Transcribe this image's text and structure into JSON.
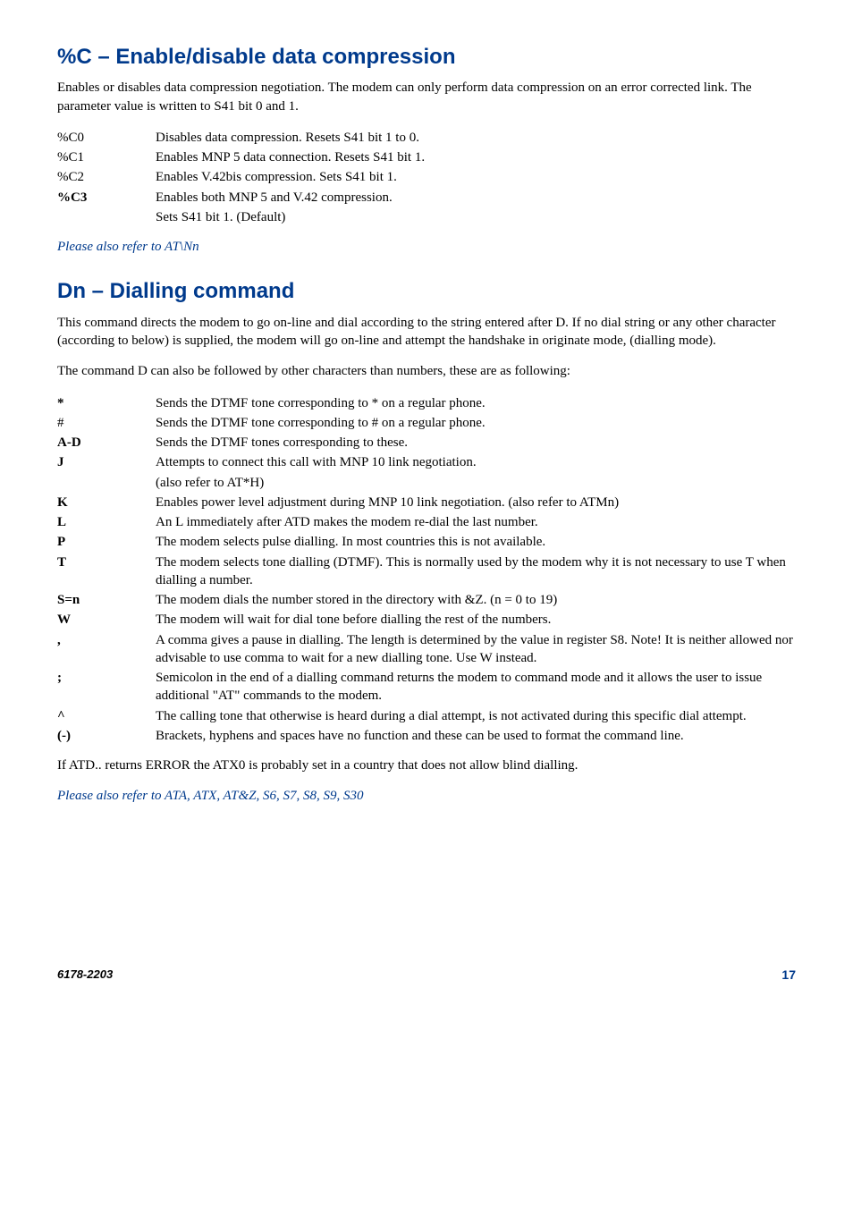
{
  "section1": {
    "heading": "%C – Enable/disable data compression",
    "intro": "Enables or disables data compression negotiation. The modem can only perform data compression on an error corrected link. The parameter value is written to S41 bit 0 and 1.",
    "items": [
      {
        "term": "%C0",
        "bold": false,
        "desc": "Disables data compression. Resets S41 bit 1 to 0."
      },
      {
        "term": "%C1",
        "bold": false,
        "desc": "Enables MNP 5 data connection. Resets S41 bit 1."
      },
      {
        "term": "%C2",
        "bold": false,
        "desc": "Enables V.42bis compression. Sets S41 bit 1."
      },
      {
        "term": "%C3",
        "bold": true,
        "desc": "Enables both MNP 5 and V.42 compression."
      },
      {
        "term": "",
        "bold": false,
        "desc": "Sets S41 bit 1. (Default)"
      }
    ],
    "see_also": "Please also refer to AT\\Nn"
  },
  "section2": {
    "heading": "Dn – Dialling command",
    "intro1": "This command directs the modem to go on-line and dial according to the string entered after D. If no dial string or any other character (according to below) is supplied, the modem will go on-line and attempt the handshake in originate mode, (dialling mode).",
    "intro2": "The command D can also be followed by other characters than numbers, these are as following:",
    "items": [
      {
        "term": "*",
        "bold": true,
        "desc": "Sends the DTMF tone corresponding to * on a regular phone."
      },
      {
        "term": "#",
        "bold": false,
        "desc": "Sends the DTMF tone corresponding to # on a regular phone."
      },
      {
        "term": "A-D",
        "bold": true,
        "desc": "Sends the DTMF tones corresponding to these."
      },
      {
        "term": "J",
        "bold": true,
        "desc": "Attempts to connect this call with MNP 10 link negotiation."
      },
      {
        "term": "",
        "bold": false,
        "desc": "(also refer to AT*H)"
      },
      {
        "term": "K",
        "bold": true,
        "desc": "Enables power level adjustment during MNP 10 link negotiation. (also refer to ATMn)"
      },
      {
        "term": "L",
        "bold": true,
        "desc": "An L immediately after ATD makes the modem re-dial the last number."
      },
      {
        "term": "P",
        "bold": true,
        "desc": "The modem selects pulse dialling. In most countries this is not available."
      },
      {
        "term": "T",
        "bold": true,
        "desc": "The modem selects tone dialling (DTMF). This is normally used by the modem why it is not necessary to use T when dialling a number."
      },
      {
        "term": "S=n",
        "bold": true,
        "desc": "The modem dials the number stored in the directory with &Z. (n = 0 to 19)"
      },
      {
        "term": "W",
        "bold": true,
        "desc": "The modem will wait for dial tone before dialling the rest of the numbers."
      },
      {
        "term": ",",
        "bold": true,
        "desc": "A comma gives a pause in dialling. The length is determined by the value in register S8. Note! It is neither allowed nor advisable to use comma to wait for a new dialling tone. Use W instead."
      },
      {
        "term": ";",
        "bold": true,
        "desc": "Semicolon in the end of a dialling command returns the modem to command mode and it allows the user to issue additional \"AT\" commands to the modem."
      },
      {
        "term": "^",
        "bold": true,
        "desc": "The calling tone that otherwise is heard during a dial attempt, is not activated during this specific dial attempt."
      },
      {
        "term": "(-)",
        "bold": true,
        "desc": "Brackets, hyphens and spaces have no function and these can be used to format the command line."
      }
    ],
    "post": "If ATD.. returns ERROR the ATX0 is probably set in a country that does not allow blind dialling.",
    "see_also": "Please also refer to ATA, ATX, AT&Z, S6, S7, S8, S9, S30"
  },
  "footer": {
    "doc": "6178-2203",
    "page": "17"
  }
}
